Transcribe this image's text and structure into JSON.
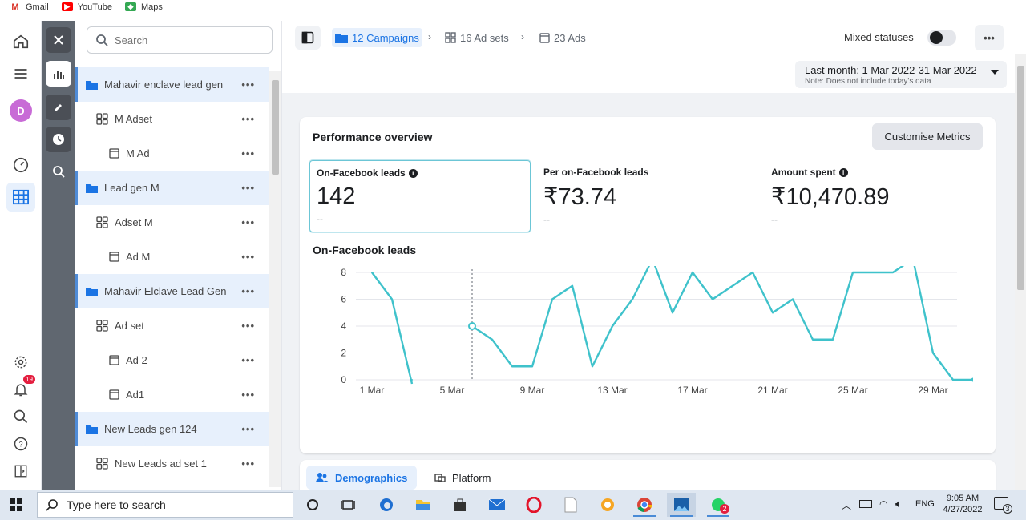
{
  "bookmarks": [
    {
      "label": "Gmail",
      "icon": "gmail-icon",
      "color": "#d93025"
    },
    {
      "label": "YouTube",
      "icon": "youtube-icon",
      "color": "#ff0000"
    },
    {
      "label": "Maps",
      "icon": "maps-icon",
      "color": "#34a853"
    }
  ],
  "leftnav": {
    "avatar_letter": "D",
    "notification_count": "19"
  },
  "tree": {
    "search_placeholder": "Search",
    "rows": [
      {
        "type": "campaign",
        "label": "Mahavir enclave lead gen"
      },
      {
        "type": "adset",
        "label": "M Adset"
      },
      {
        "type": "ad",
        "label": "M Ad"
      },
      {
        "type": "campaign",
        "label": "Lead gen M"
      },
      {
        "type": "adset",
        "label": "Adset M"
      },
      {
        "type": "ad",
        "label": "Ad M"
      },
      {
        "type": "campaign",
        "label": "Mahavir Elclave Lead Gen"
      },
      {
        "type": "adset",
        "label": "Ad set"
      },
      {
        "type": "ad",
        "label": "Ad 2"
      },
      {
        "type": "ad",
        "label": "Ad1"
      },
      {
        "type": "campaign",
        "label": "New Leads gen 124"
      },
      {
        "type": "adset",
        "label": "New Leads ad set 1"
      }
    ],
    "more_label": "•••"
  },
  "toolbar": {
    "campaigns": "12 Campaigns",
    "adsets": "16 Ad sets",
    "ads": "23 Ads",
    "mixed_status": "Mixed statuses",
    "more": "•••"
  },
  "date": {
    "range": "Last month: 1 Mar 2022-31 Mar 2022",
    "note": "Note: Does not include today's data"
  },
  "performance": {
    "title": "Performance overview",
    "customise": "Customise Metrics",
    "metrics": [
      {
        "label": "On-Facebook leads",
        "value": "142",
        "delta": "--",
        "info": true
      },
      {
        "label": "Per on-Facebook leads",
        "value": "₹73.74",
        "delta": "--",
        "info": false
      },
      {
        "label": "Amount spent",
        "value": "₹10,470.89",
        "delta": "--",
        "info": true
      }
    ],
    "chart_title": "On-Facebook leads"
  },
  "chart_data": {
    "type": "line",
    "title": "On-Facebook leads",
    "x": [
      1,
      2,
      3,
      4,
      5,
      6,
      7,
      8,
      9,
      10,
      11,
      12,
      13,
      14,
      15,
      16,
      17,
      18,
      19,
      20,
      21,
      22,
      23,
      24,
      25,
      26,
      27,
      28,
      29,
      30,
      31
    ],
    "x_tick_labels": [
      "1 Mar",
      "5 Mar",
      "9 Mar",
      "13 Mar",
      "17 Mar",
      "21 Mar",
      "25 Mar",
      "29 Mar"
    ],
    "x_tick_values": [
      1,
      5,
      9,
      13,
      17,
      21,
      25,
      29
    ],
    "y_ticks": [
      0,
      2,
      4,
      6,
      8
    ],
    "ylim": [
      0,
      8
    ],
    "series": [
      {
        "color": "#3fc2cb",
        "values": [
          8,
          6,
          -2,
          null,
          null,
          4,
          3,
          1,
          1,
          6,
          7,
          1,
          4,
          6,
          9,
          5,
          8,
          6,
          7,
          8,
          5,
          6,
          3,
          3,
          8,
          8,
          8,
          9,
          2,
          0,
          0
        ]
      }
    ],
    "hover_x": 6,
    "grid": true
  },
  "tabs": [
    {
      "label": "Demographics",
      "icon": "people-icon"
    },
    {
      "label": "Platform",
      "icon": "platform-icon"
    }
  ],
  "taskbar": {
    "search_placeholder": "Type here to search",
    "lang": "ENG",
    "time": "9:05 AM",
    "date": "4/27/2022",
    "notif": "3",
    "whatsapp_badge": "2"
  }
}
